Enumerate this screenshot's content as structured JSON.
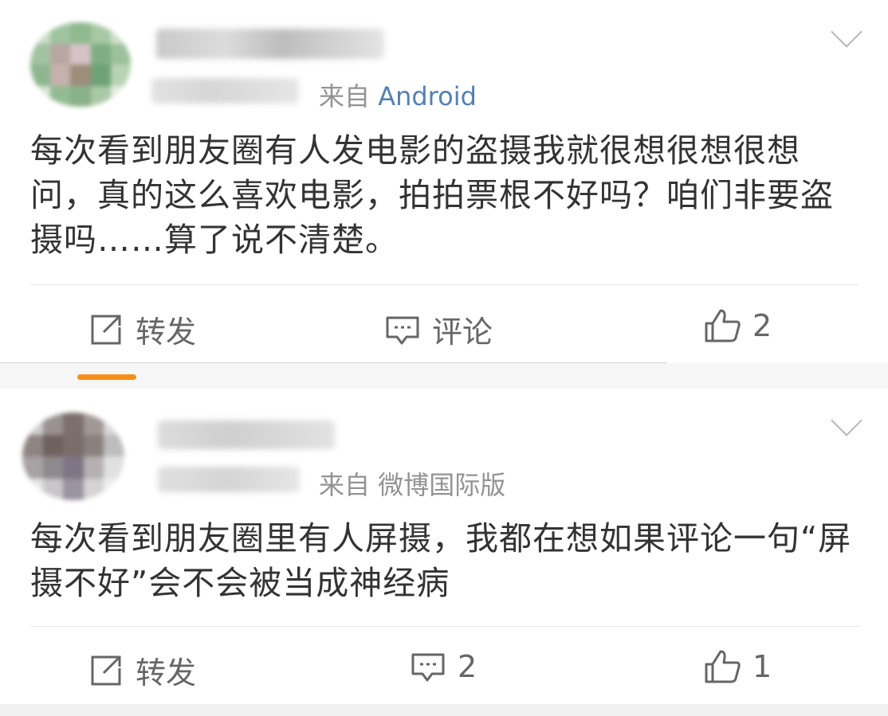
{
  "posts": [
    {
      "source_prefix": "来自",
      "source_device": "Android",
      "content": "每次看到朋友圈有人发电影的盗摄我就很想很想很想问，真的这么喜欢电影，拍拍票根不好吗？咱们非要盗摄吗……算了说不清楚。",
      "actions": {
        "repost_label": "转发",
        "comment_label": "评论",
        "like_count": "2"
      },
      "icons": {
        "repost": "share-square-icon",
        "comment": "comment-bubble-icon",
        "like": "thumbs-up-icon",
        "more": "chevron-down-icon"
      }
    },
    {
      "source_prefix": "来自",
      "source_device": "微博国际版",
      "content": "每次看到朋友圈里有人屏摄，我都在想如果评论一句“屏摄不好”会不会被当成神经病",
      "actions": {
        "repost_label": "转发",
        "comment_count": "2",
        "like_count": "1"
      },
      "icons": {
        "repost": "share-square-icon",
        "comment": "comment-bubble-icon",
        "like": "thumbs-up-icon",
        "more": "chevron-down-icon"
      }
    }
  ],
  "colors": {
    "text": "#333333",
    "muted": "#939393",
    "device_link": "#5480b0",
    "tab_indicator": "#f78f1a"
  }
}
